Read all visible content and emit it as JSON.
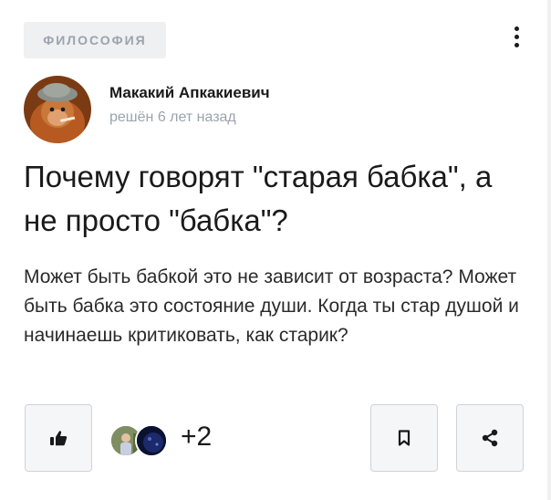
{
  "post": {
    "category": "ФИЛОСОФИЯ",
    "author_name": "Макакий Апкакиевич",
    "status_time": "решён 6 лет назад",
    "title": "Почему говорят \"старая бабка\", а не просто \"бабка\"?",
    "body": "Может быть бабкой это не зависит от возраста? Может быть бабка это состояние души. Когда ты стар душой и начинаешь критиковать, как старик?"
  },
  "actions": {
    "likers_extra_count": "+2",
    "like_icon": "thumbs-up-icon",
    "bookmark_icon": "bookmark-icon",
    "share_icon": "share-icon",
    "menu_icon": "more-vertical-icon"
  },
  "colors": {
    "tag_background": "#eef0f2",
    "muted_text": "#9aa3ad",
    "button_border": "#cfd4d9"
  }
}
